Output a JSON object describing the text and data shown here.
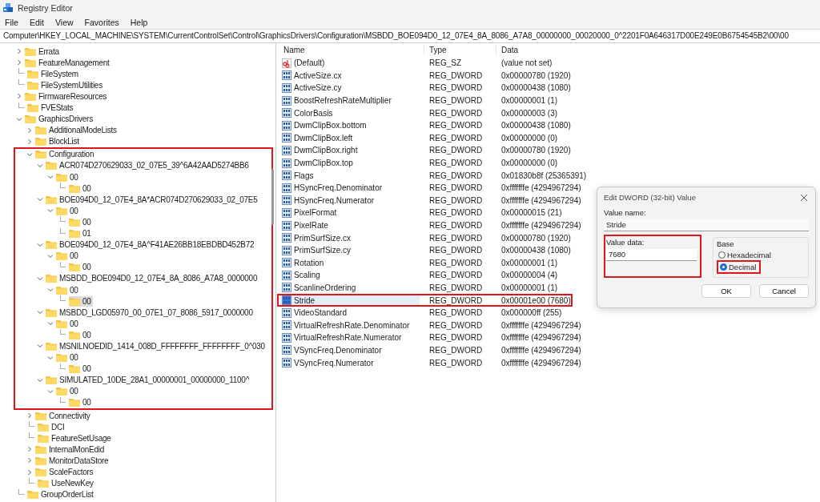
{
  "window": {
    "title": "Registry Editor"
  },
  "menu": [
    "File",
    "Edit",
    "View",
    "Favorites",
    "Help"
  ],
  "address": "Computer\\HKEY_LOCAL_MACHINE\\SYSTEM\\CurrentControlSet\\Control\\GraphicsDrivers\\Configuration\\MSBDD_BOE094D0_12_07E4_8A_8086_A7A8_00000000_00020000_0^2201F0A646317D00E249E0B6754545B2\\00\\00",
  "tree": [
    {
      "label": "Errata",
      "kind": "branch",
      "expanded": false,
      "selected": false
    },
    {
      "label": "FeatureManagement",
      "kind": "branch",
      "expanded": false,
      "selected": false
    },
    {
      "label": "FileSystem",
      "kind": "leaf",
      "selected": false
    },
    {
      "label": "FileSystemUtilities",
      "kind": "leaf",
      "selected": false
    },
    {
      "label": "FirmwareResources",
      "kind": "branch",
      "expanded": false,
      "selected": false
    },
    {
      "label": "FVEStats",
      "kind": "leaf",
      "selected": false
    },
    {
      "label": "GraphicsDrivers",
      "kind": "branch",
      "expanded": true,
      "selected": false,
      "children": [
        {
          "label": "AdditionalModeLists",
          "kind": "branch",
          "expanded": false,
          "selected": false
        },
        {
          "label": "BlockList",
          "kind": "branch",
          "expanded": false,
          "selected": false
        },
        {
          "label": "Configuration",
          "kind": "branch",
          "expanded": true,
          "selected": false,
          "highlighted": true,
          "children": [
            {
              "label": "ACR074D270629033_02_07E5_39^6A42AAD5274BB6",
              "kind": "branch",
              "expanded": true,
              "selected": false,
              "children": [
                {
                  "label": "00",
                  "kind": "branch",
                  "expanded": true,
                  "selected": false,
                  "children": [
                    {
                      "label": "00",
                      "kind": "leaf",
                      "selected": false
                    }
                  ]
                }
              ]
            },
            {
              "label": "BOE094D0_12_07E4_8A*ACR074D270629033_02_07E5",
              "kind": "branch",
              "expanded": true,
              "selected": false,
              "children": [
                {
                  "label": "00",
                  "kind": "branch",
                  "expanded": true,
                  "selected": false,
                  "children": [
                    {
                      "label": "00",
                      "kind": "leaf",
                      "selected": false
                    },
                    {
                      "label": "01",
                      "kind": "leaf",
                      "selected": false
                    }
                  ]
                }
              ]
            },
            {
              "label": "BOE094D0_12_07E4_8A^F41AE26BB18EBDBD452B72",
              "kind": "branch",
              "expanded": true,
              "selected": false,
              "children": [
                {
                  "label": "00",
                  "kind": "branch",
                  "expanded": true,
                  "selected": false,
                  "children": [
                    {
                      "label": "00",
                      "kind": "leaf",
                      "selected": false
                    }
                  ]
                }
              ]
            },
            {
              "label": "MSBDD_BOE094D0_12_07E4_8A_8086_A7A8_0000000",
              "kind": "branch",
              "expanded": true,
              "selected": false,
              "children": [
                {
                  "label": "00",
                  "kind": "branch",
                  "expanded": true,
                  "selected": false,
                  "children": [
                    {
                      "label": "00",
                      "kind": "leaf",
                      "selected": true
                    }
                  ]
                }
              ]
            },
            {
              "label": "MSBDD_LGD05970_00_07E1_07_8086_5917_0000000",
              "kind": "branch",
              "expanded": true,
              "selected": false,
              "children": [
                {
                  "label": "00",
                  "kind": "branch",
                  "expanded": true,
                  "selected": false,
                  "children": [
                    {
                      "label": "00",
                      "kind": "leaf",
                      "selected": false
                    }
                  ]
                }
              ]
            },
            {
              "label": "MSNILNOEDID_1414_008D_FFFFFFFF_FFFFFFFF_0^030",
              "kind": "branch",
              "expanded": true,
              "selected": false,
              "children": [
                {
                  "label": "00",
                  "kind": "branch",
                  "expanded": true,
                  "selected": false,
                  "children": [
                    {
                      "label": "00",
                      "kind": "leaf",
                      "selected": false
                    }
                  ]
                }
              ]
            },
            {
              "label": "SIMULATED_10DE_28A1_00000001_00000000_1100^",
              "kind": "branch",
              "expanded": true,
              "selected": false,
              "children": [
                {
                  "label": "00",
                  "kind": "branch",
                  "expanded": true,
                  "selected": false,
                  "children": [
                    {
                      "label": "00",
                      "kind": "leaf",
                      "selected": false
                    }
                  ]
                }
              ]
            }
          ]
        },
        {
          "label": "Connectivity",
          "kind": "branch",
          "expanded": false,
          "selected": false
        },
        {
          "label": "DCI",
          "kind": "leaf",
          "selected": false
        },
        {
          "label": "FeatureSetUsage",
          "kind": "leaf",
          "selected": false
        },
        {
          "label": "InternalMonEdid",
          "kind": "branch",
          "expanded": false,
          "selected": false
        },
        {
          "label": "MonitorDataStore",
          "kind": "branch",
          "expanded": false,
          "selected": false
        },
        {
          "label": "ScaleFactors",
          "kind": "branch",
          "expanded": false,
          "selected": false
        },
        {
          "label": "UseNewKey",
          "kind": "leaf",
          "selected": false
        }
      ]
    },
    {
      "label": "GroupOrderList",
      "kind": "leaf",
      "selected": false
    }
  ],
  "table": {
    "columns": [
      "Name",
      "Type",
      "Data"
    ],
    "rows": [
      {
        "kind": "string",
        "name": "(Default)",
        "type": "REG_SZ",
        "data": "(value not set)",
        "selected": false,
        "highlighted": false
      },
      {
        "kind": "binary",
        "name": "ActiveSize.cx",
        "type": "REG_DWORD",
        "data": "0x00000780 (1920)",
        "selected": false,
        "highlighted": false
      },
      {
        "kind": "binary",
        "name": "ActiveSize.cy",
        "type": "REG_DWORD",
        "data": "0x00000438 (1080)",
        "selected": false,
        "highlighted": false
      },
      {
        "kind": "binary",
        "name": "BoostRefreshRateMultiplier",
        "type": "REG_DWORD",
        "data": "0x00000001 (1)",
        "selected": false,
        "highlighted": false
      },
      {
        "kind": "binary",
        "name": "ColorBasis",
        "type": "REG_DWORD",
        "data": "0x00000003 (3)",
        "selected": false,
        "highlighted": false
      },
      {
        "kind": "binary",
        "name": "DwmClipBox.bottom",
        "type": "REG_DWORD",
        "data": "0x00000438 (1080)",
        "selected": false,
        "highlighted": false
      },
      {
        "kind": "binary",
        "name": "DwmClipBox.left",
        "type": "REG_DWORD",
        "data": "0x00000000 (0)",
        "selected": false,
        "highlighted": false
      },
      {
        "kind": "binary",
        "name": "DwmClipBox.right",
        "type": "REG_DWORD",
        "data": "0x00000780 (1920)",
        "selected": false,
        "highlighted": false
      },
      {
        "kind": "binary",
        "name": "DwmClipBox.top",
        "type": "REG_DWORD",
        "data": "0x00000000 (0)",
        "selected": false,
        "highlighted": false
      },
      {
        "kind": "binary",
        "name": "Flags",
        "type": "REG_DWORD",
        "data": "0x01830b8f (25365391)",
        "selected": false,
        "highlighted": false
      },
      {
        "kind": "binary",
        "name": "HSyncFreq.Denominator",
        "type": "REG_DWORD",
        "data": "0xfffffffe (4294967294)",
        "selected": false,
        "highlighted": false
      },
      {
        "kind": "binary",
        "name": "HSyncFreq.Numerator",
        "type": "REG_DWORD",
        "data": "0xfffffffe (4294967294)",
        "selected": false,
        "highlighted": false
      },
      {
        "kind": "binary",
        "name": "PixelFormat",
        "type": "REG_DWORD",
        "data": "0x00000015 (21)",
        "selected": false,
        "highlighted": false
      },
      {
        "kind": "binary",
        "name": "PixelRate",
        "type": "REG_DWORD",
        "data": "0xfffffffe (4294967294)",
        "selected": false,
        "highlighted": false
      },
      {
        "kind": "binary",
        "name": "PrimSurfSize.cx",
        "type": "REG_DWORD",
        "data": "0x00000780 (1920)",
        "selected": false,
        "highlighted": false
      },
      {
        "kind": "binary",
        "name": "PrimSurfSize.cy",
        "type": "REG_DWORD",
        "data": "0x00000438 (1080)",
        "selected": false,
        "highlighted": false
      },
      {
        "kind": "binary",
        "name": "Rotation",
        "type": "REG_DWORD",
        "data": "0x00000001 (1)",
        "selected": false,
        "highlighted": false
      },
      {
        "kind": "binary",
        "name": "Scaling",
        "type": "REG_DWORD",
        "data": "0x00000004 (4)",
        "selected": false,
        "highlighted": false
      },
      {
        "kind": "binary",
        "name": "ScanlineOrdering",
        "type": "REG_DWORD",
        "data": "0x00000001 (1)",
        "selected": false,
        "highlighted": false
      },
      {
        "kind": "binary",
        "name": "Stride",
        "type": "REG_DWORD",
        "data": "0x00001e00 (7680)",
        "selected": true,
        "highlighted": true
      },
      {
        "kind": "binary",
        "name": "VideoStandard",
        "type": "REG_DWORD",
        "data": "0x000000ff (255)",
        "selected": false,
        "highlighted": false
      },
      {
        "kind": "binary",
        "name": "VirtualRefreshRate.Denominator",
        "type": "REG_DWORD",
        "data": "0xfffffffe (4294967294)",
        "selected": false,
        "highlighted": false
      },
      {
        "kind": "binary",
        "name": "VirtualRefreshRate.Numerator",
        "type": "REG_DWORD",
        "data": "0xfffffffe (4294967294)",
        "selected": false,
        "highlighted": false
      },
      {
        "kind": "binary",
        "name": "VSyncFreq.Denominator",
        "type": "REG_DWORD",
        "data": "0xfffffffe (4294967294)",
        "selected": false,
        "highlighted": false
      },
      {
        "kind": "binary",
        "name": "VSyncFreq.Numerator",
        "type": "REG_DWORD",
        "data": "0xfffffffe (4294967294)",
        "selected": false,
        "highlighted": false
      }
    ]
  },
  "dialog": {
    "title": "Edit DWORD (32-bit) Value",
    "value_name": {
      "label": "Value name:",
      "value": "Stride"
    },
    "value_data": {
      "label": "Value data:",
      "value": "7680",
      "highlighted": true
    },
    "base": {
      "label": "Base",
      "options": [
        {
          "label": "Hexadecimal",
          "selected": false,
          "highlighted": false
        },
        {
          "label": "Decimal",
          "selected": true,
          "highlighted": true
        }
      ]
    },
    "buttons": [
      "OK",
      "Cancel"
    ]
  }
}
